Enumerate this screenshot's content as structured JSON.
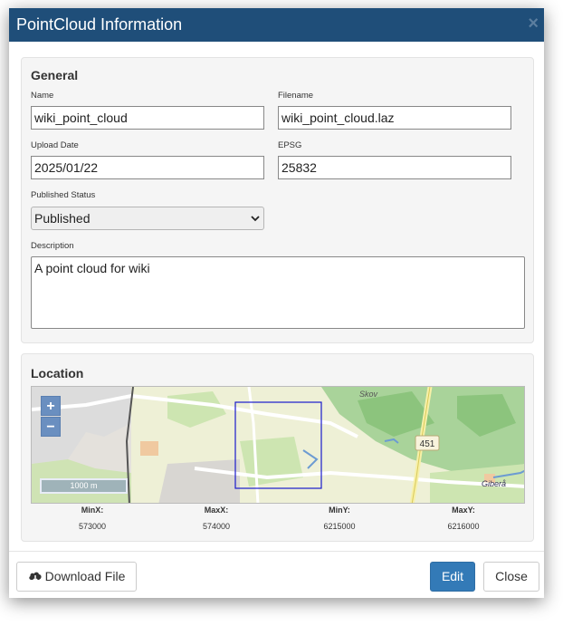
{
  "dialog": {
    "title": "PointCloud Information",
    "close_glyph": "×"
  },
  "general": {
    "heading": "General",
    "name_label": "Name",
    "name_value": "wiki_point_cloud",
    "filename_label": "Filename",
    "filename_value": "wiki_point_cloud.laz",
    "upload_date_label": "Upload Date",
    "upload_date_value": "2025/01/22",
    "epsg_label": "EPSG",
    "epsg_value": "25832",
    "status_label": "Published Status",
    "status_value": "Published",
    "description_label": "Description",
    "description_value": "A point cloud for wiki"
  },
  "location": {
    "heading": "Location",
    "zoom_in": "+",
    "zoom_out": "−",
    "scale_label": "1000 m",
    "map_labels": {
      "road_number": "451",
      "place_skov": "Skov",
      "place_gibera": "Giberå"
    },
    "coords": [
      {
        "label": "MinX:",
        "value": "573000"
      },
      {
        "label": "MaxX:",
        "value": "574000"
      },
      {
        "label": "MinY:",
        "value": "6215000"
      },
      {
        "label": "MaxY:",
        "value": "6216000"
      }
    ]
  },
  "footer": {
    "download_label": "Download File",
    "edit_label": "Edit",
    "close_label": "Close"
  },
  "colors": {
    "titlebar": "#1f4e79",
    "primary": "#337ab7",
    "bbox": "#1a1acc"
  }
}
